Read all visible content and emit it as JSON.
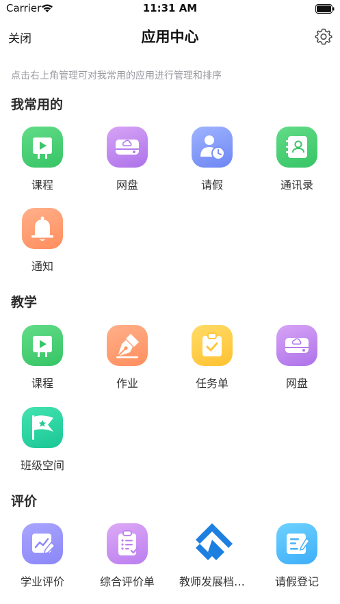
{
  "status_bar": {
    "carrier": "Carrier",
    "time": "11:31 AM"
  },
  "nav": {
    "close_label": "关闭",
    "title": "应用中心",
    "settings_icon": "gear-icon"
  },
  "hint": "点击右上角管理可对我常用的应用进行管理和排序",
  "sections": [
    {
      "title": "我常用的",
      "apps": [
        {
          "label": "课程",
          "icon": "play-board-icon"
        },
        {
          "label": "网盘",
          "icon": "cloud-drive-icon"
        },
        {
          "label": "请假",
          "icon": "person-clock-icon"
        },
        {
          "label": "通讯录",
          "icon": "contacts-book-icon"
        },
        {
          "label": "通知",
          "icon": "bell-icon"
        }
      ]
    },
    {
      "title": "教学",
      "apps": [
        {
          "label": "课程",
          "icon": "play-board-icon"
        },
        {
          "label": "作业",
          "icon": "pen-nib-icon"
        },
        {
          "label": "任务单",
          "icon": "clipboard-check-icon"
        },
        {
          "label": "网盘",
          "icon": "cloud-drive-icon"
        },
        {
          "label": "班级空间",
          "icon": "flag-star-icon"
        }
      ]
    },
    {
      "title": "评价",
      "apps": [
        {
          "label": "学业评价",
          "icon": "chart-pen-icon"
        },
        {
          "label": "综合评价单",
          "icon": "checklist-icon"
        },
        {
          "label": "教师发展档…",
          "icon": "diamond-logo-icon"
        },
        {
          "label": "请假登记",
          "icon": "form-pen-icon"
        }
      ]
    }
  ]
}
